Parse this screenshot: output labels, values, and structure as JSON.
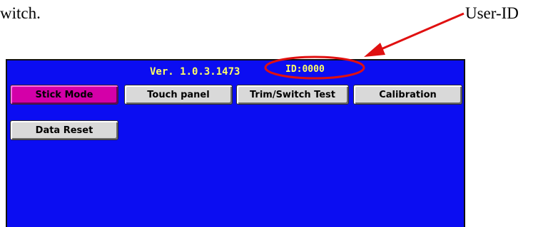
{
  "document": {
    "leading_text": "witch.",
    "callout_label": "User-ID"
  },
  "device_screen": {
    "version": "Ver. 1.0.3.1473",
    "user_id": "ID:0000",
    "buttons": [
      {
        "label": "Stick Mode",
        "active": true
      },
      {
        "label": "Touch panel",
        "active": false
      },
      {
        "label": "Trim/Switch Test",
        "active": false
      },
      {
        "label": "Calibration",
        "active": false
      },
      {
        "label": "Data Reset",
        "active": false
      }
    ]
  },
  "colors": {
    "screen_bg": "#0b0df2",
    "header_text": "#ffff66",
    "active_button": "#d400a8",
    "button": "#d9d9d9",
    "annotation": "#e01010"
  }
}
